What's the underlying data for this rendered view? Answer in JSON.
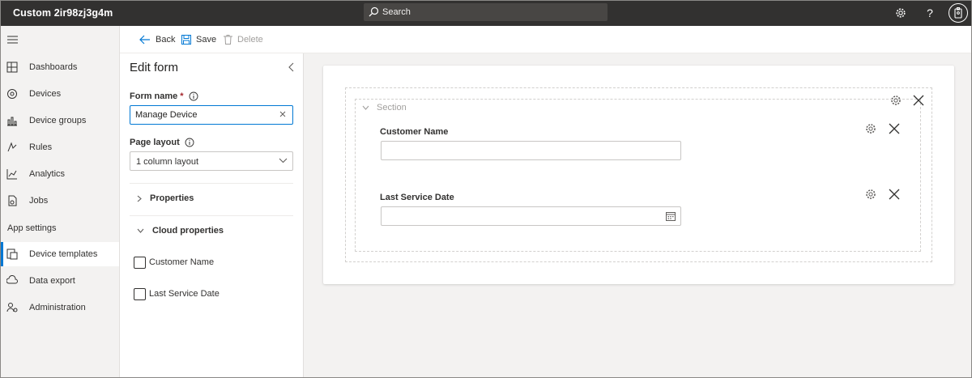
{
  "header": {
    "app_title": "Custom 2ir98zj3g4m",
    "search_placeholder": "Search"
  },
  "nav": {
    "items": [
      {
        "label": "Dashboards",
        "icon": "dashboard-icon"
      },
      {
        "label": "Devices",
        "icon": "devices-icon"
      },
      {
        "label": "Device groups",
        "icon": "device-groups-icon"
      },
      {
        "label": "Rules",
        "icon": "rules-icon"
      },
      {
        "label": "Analytics",
        "icon": "analytics-icon"
      },
      {
        "label": "Jobs",
        "icon": "jobs-icon"
      }
    ],
    "section_header": "App settings",
    "settings_items": [
      {
        "label": "Device templates",
        "icon": "device-templates-icon",
        "selected": true
      },
      {
        "label": "Data export",
        "icon": "data-export-icon"
      },
      {
        "label": "Administration",
        "icon": "administration-icon"
      }
    ]
  },
  "toolbar": {
    "back_label": "Back",
    "save_label": "Save",
    "delete_label": "Delete"
  },
  "edit_form": {
    "title": "Edit form",
    "form_name_label": "Form name",
    "required_marker": "*",
    "form_name_value": "Manage Device",
    "page_layout_label": "Page layout",
    "page_layout_value": "1 column layout",
    "properties_label": "Properties",
    "cloud_properties_label": "Cloud properties",
    "cloud_properties": [
      {
        "label": "Customer Name",
        "checked": false
      },
      {
        "label": "Last Service Date",
        "checked": false
      }
    ]
  },
  "canvas": {
    "section_title": "Section",
    "fields": [
      {
        "label": "Customer Name",
        "value": ""
      },
      {
        "label": "Last Service Date",
        "value": ""
      }
    ]
  },
  "colors": {
    "topbar": "#323130",
    "accent": "#0078d4",
    "nav_background": "#f3f2f1"
  }
}
